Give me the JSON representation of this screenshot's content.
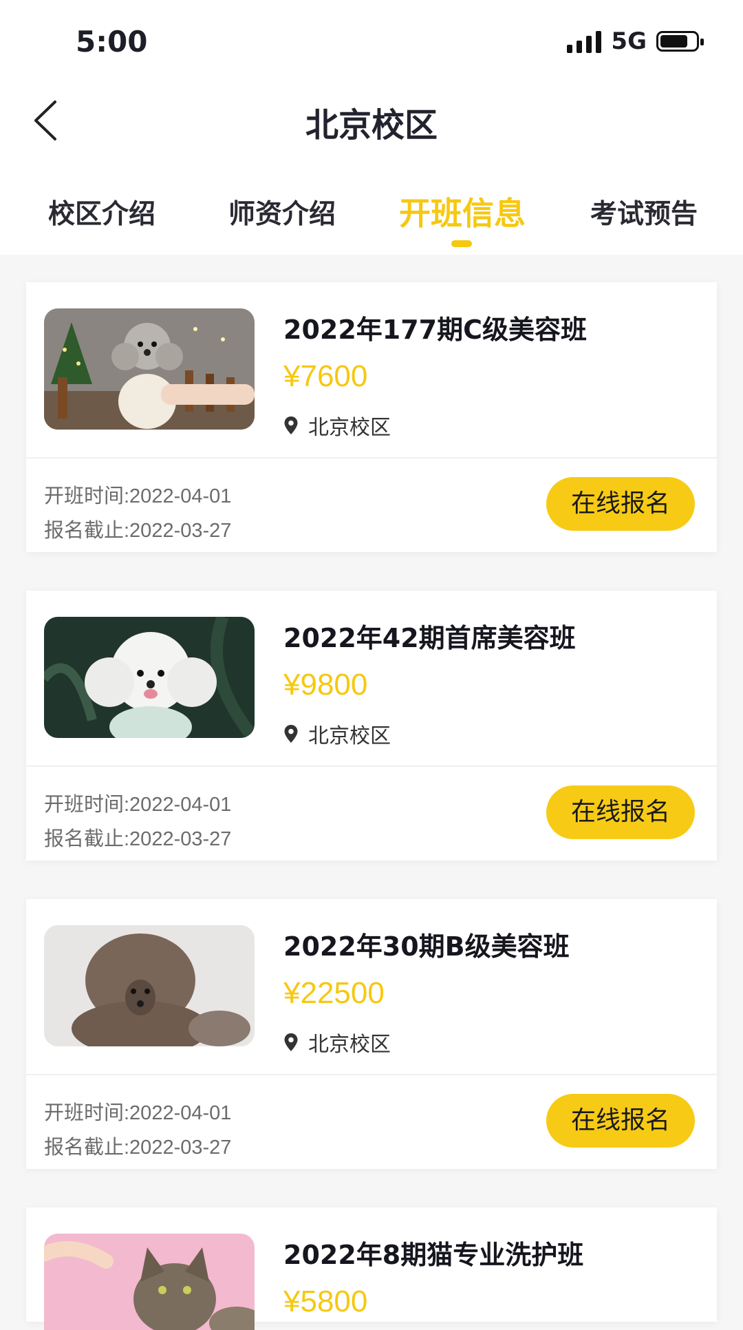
{
  "status_bar": {
    "time": "5:00",
    "network": "5G"
  },
  "header": {
    "title": "北京校区"
  },
  "tabs": [
    {
      "label": "校区介绍"
    },
    {
      "label": "师资介绍"
    },
    {
      "label": "开班信息",
      "active": true
    },
    {
      "label": "考试预告"
    }
  ],
  "courses": [
    {
      "title": "2022年177期C级美容班",
      "price": "¥7600",
      "location": "北京校区",
      "start": "开班时间:2022-04-01",
      "deadline": "报名截止:2022-03-27",
      "button": "在线报名"
    },
    {
      "title": "2022年42期首席美容班",
      "price": "¥9800",
      "location": "北京校区",
      "start": "开班时间:2022-04-01",
      "deadline": "报名截止:2022-03-27",
      "button": "在线报名"
    },
    {
      "title": "2022年30期B级美容班",
      "price": "¥22500",
      "location": "北京校区",
      "start": "开班时间:2022-04-01",
      "deadline": "报名截止:2022-03-27",
      "button": "在线报名"
    },
    {
      "title": "2022年8期猫专业洗护班",
      "price": "¥5800"
    }
  ],
  "colors": {
    "accent": "#f6c810",
    "button": "#f7cb15",
    "background": "#f6f6f6"
  }
}
